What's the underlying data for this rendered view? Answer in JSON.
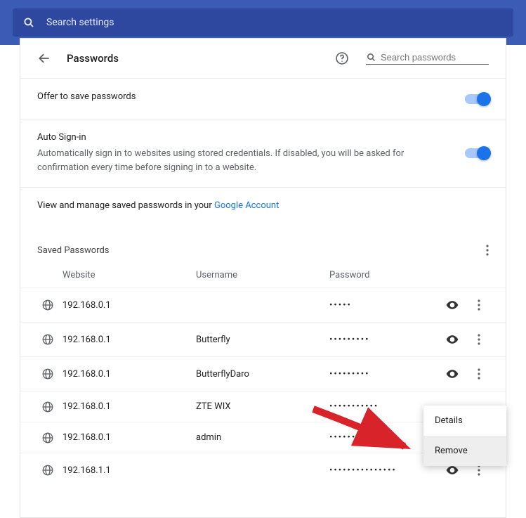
{
  "topbar": {
    "placeholder": "Search settings"
  },
  "header": {
    "title": "Passwords",
    "search_placeholder": "Search passwords"
  },
  "offer": {
    "label": "Offer to save passwords"
  },
  "autosignin": {
    "label": "Auto Sign-in",
    "desc": "Automatically sign in to websites using stored credentials. If disabled, you will be asked for confirmation every time before signing in to a website."
  },
  "account": {
    "prefix": "View and manage saved passwords in your ",
    "link": "Google Account"
  },
  "saved": {
    "title": "Saved Passwords",
    "columns": {
      "website": "Website",
      "username": "Username",
      "password": "Password"
    },
    "rows": [
      {
        "site": "192.168.0.1",
        "user": "",
        "pwd": "•••••",
        "show_actions": true
      },
      {
        "site": "192.168.0.1",
        "user": "Butterfly",
        "pwd": "•••••••••",
        "show_actions": true
      },
      {
        "site": "192.168.0.1",
        "user": "ButterflyDaro",
        "pwd": "•••••••••",
        "show_actions": true
      },
      {
        "site": "192.168.0.1",
        "user": "ZTE WIX",
        "pwd": "•••••••••••",
        "show_actions": false
      },
      {
        "site": "192.168.0.1",
        "user": "admin",
        "pwd": "••••••••",
        "show_actions": false
      },
      {
        "site": "192.168.1.1",
        "user": "",
        "pwd": "•••••••••••••••",
        "show_actions": true
      }
    ]
  },
  "menu": {
    "details": "Details",
    "remove": "Remove"
  }
}
